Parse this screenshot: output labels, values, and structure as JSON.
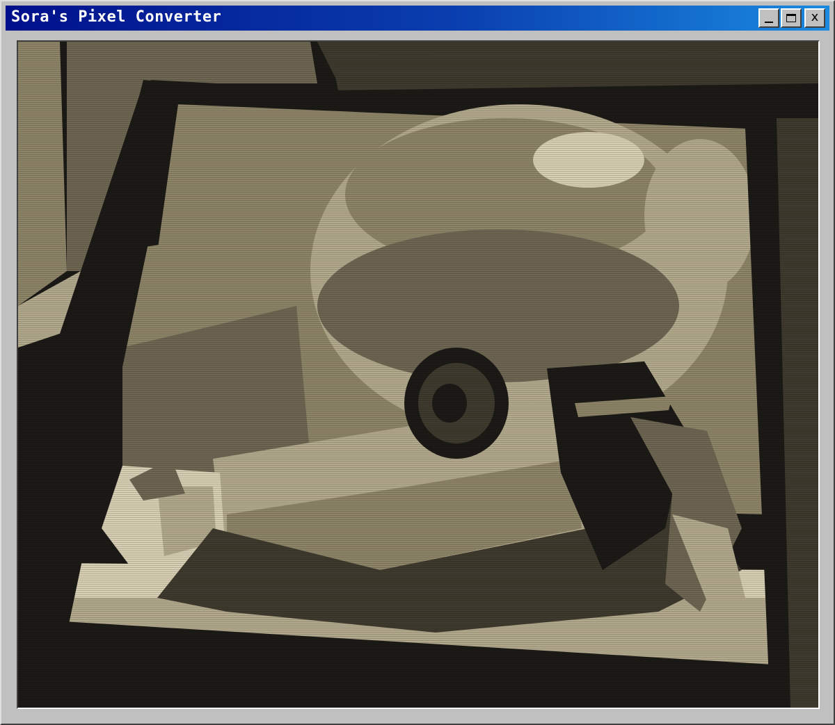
{
  "window": {
    "title": "Sora's Pixel Converter",
    "title_bar_color": "#0a3fb0"
  },
  "controls": {
    "minimize_icon": "minimize-icon",
    "maximize_icon": "maximize-icon",
    "close_label": "x"
  },
  "canvas": {
    "palette": [
      "#1c1a16",
      "#3f3a2e",
      "#6e6652",
      "#8e8468",
      "#b3a98d",
      "#d8cfb4"
    ]
  }
}
